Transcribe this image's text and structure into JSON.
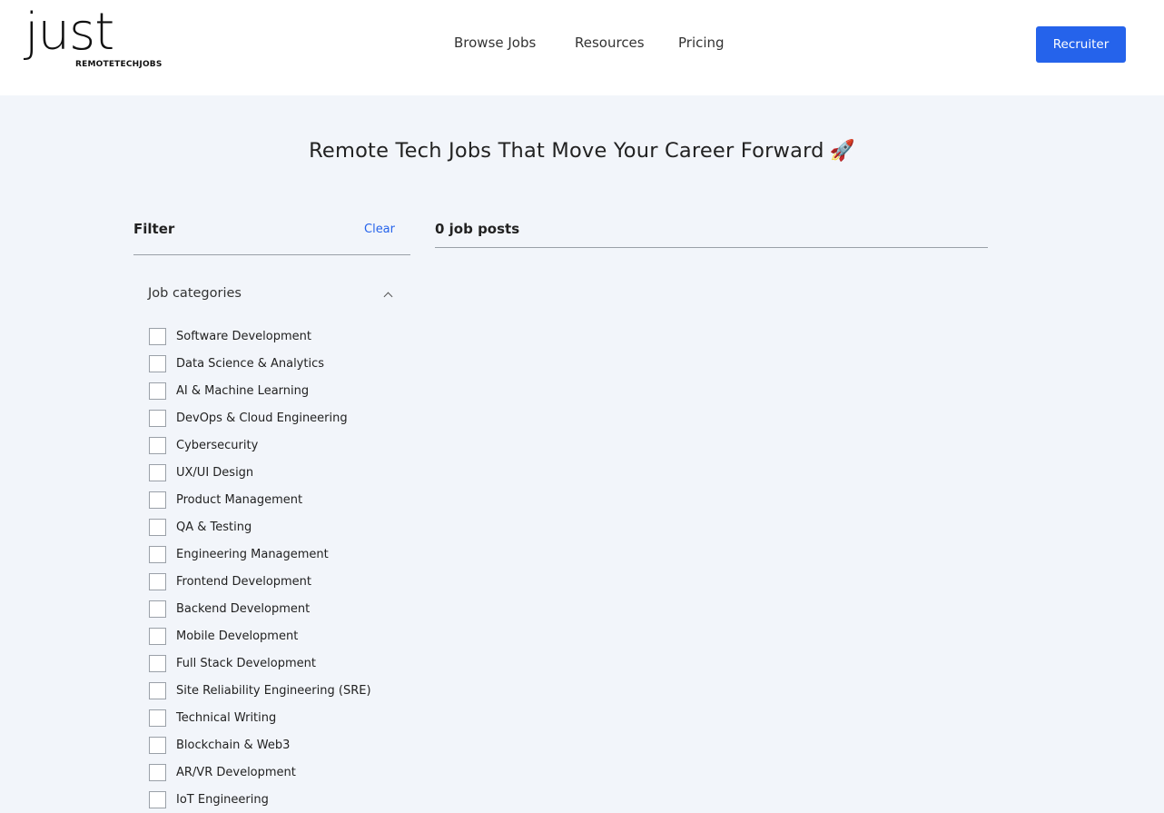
{
  "header": {
    "logo_main": "just",
    "logo_sub": "REMOTETECHJOBS",
    "nav": [
      "Browse Jobs",
      "Resources",
      "Pricing"
    ],
    "recruiter_label": "Recruiter",
    "accent_color": "#2563eb"
  },
  "hero": {
    "title": "Remote Tech Jobs That Move Your Career Forward",
    "emoji": "🚀"
  },
  "filter": {
    "title": "Filter",
    "clear_label": "Clear",
    "categories_title": "Job categories",
    "categories": [
      "Software Development",
      "Data Science & Analytics",
      "AI & Machine Learning",
      "DevOps & Cloud Engineering",
      "Cybersecurity",
      "UX/UI Design",
      "Product Management",
      "QA & Testing",
      "Engineering Management",
      "Frontend Development",
      "Backend Development",
      "Mobile Development",
      "Full Stack Development",
      "Site Reliability Engineering (SRE)",
      "Technical Writing",
      "Blockchain & Web3",
      "AR/VR Development",
      "IoT Engineering"
    ]
  },
  "results": {
    "count_label": "0 job posts"
  }
}
